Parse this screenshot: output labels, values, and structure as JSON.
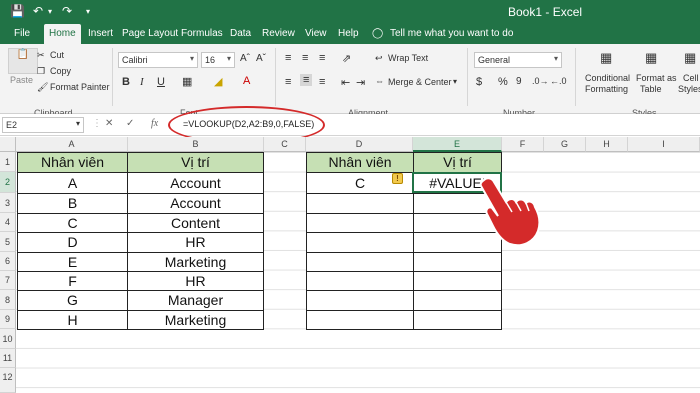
{
  "titlebar": {
    "title": "Book1  -  Excel"
  },
  "menu": {
    "items": [
      "File",
      "Home",
      "Insert",
      "Page Layout",
      "Formulas",
      "Data",
      "Review",
      "View",
      "Help"
    ],
    "tell_me": "Tell me what you want to do"
  },
  "ribbon": {
    "clipboard": {
      "paste": "Paste",
      "cut": "Cut",
      "copy": "Copy",
      "format_painter": "Format Painter",
      "group": "Clipboard"
    },
    "font": {
      "name": "Calibri",
      "size": "16",
      "group": "Font"
    },
    "alignment": {
      "wrap": "Wrap Text",
      "merge": "Merge & Center",
      "group": "Alignment"
    },
    "number": {
      "format": "General",
      "group": "Number"
    },
    "styles": {
      "conditional_1": "Conditional",
      "conditional_2": "Formatting",
      "format_table_1": "Format as",
      "format_table_2": "Table",
      "cell_styles_1": "Cell",
      "cell_styles_2": "Styles",
      "group": "Styles"
    }
  },
  "formula_bar": {
    "name_box": "E2",
    "fx": "fx",
    "formula": "=VLOOKUP(D2,A2:B9,0,FALSE)"
  },
  "sheet": {
    "columns": [
      "A",
      "B",
      "C",
      "D",
      "E",
      "F",
      "G",
      "H",
      "I"
    ],
    "rows": [
      "1",
      "2",
      "3",
      "4",
      "5",
      "6",
      "7",
      "8",
      "9",
      "10",
      "11",
      "12"
    ],
    "table1": {
      "header_a": "Nhân viên",
      "header_b": "Vị trí",
      "rows": [
        [
          "A",
          "Account"
        ],
        [
          "B",
          "Account"
        ],
        [
          "C",
          "Content"
        ],
        [
          "D",
          "HR"
        ],
        [
          "E",
          "Marketing"
        ],
        [
          "F",
          "HR"
        ],
        [
          "G",
          "Manager"
        ],
        [
          "H",
          "Marketing"
        ]
      ]
    },
    "table2": {
      "header_d": "Nhân viên",
      "header_e": "Vị trí",
      "d2": "C",
      "e2": "#VALUE!"
    }
  },
  "colors": {
    "excel_green": "#217346",
    "header_fill": "#c6e0b4",
    "annotation_red": "#d42a2a"
  }
}
